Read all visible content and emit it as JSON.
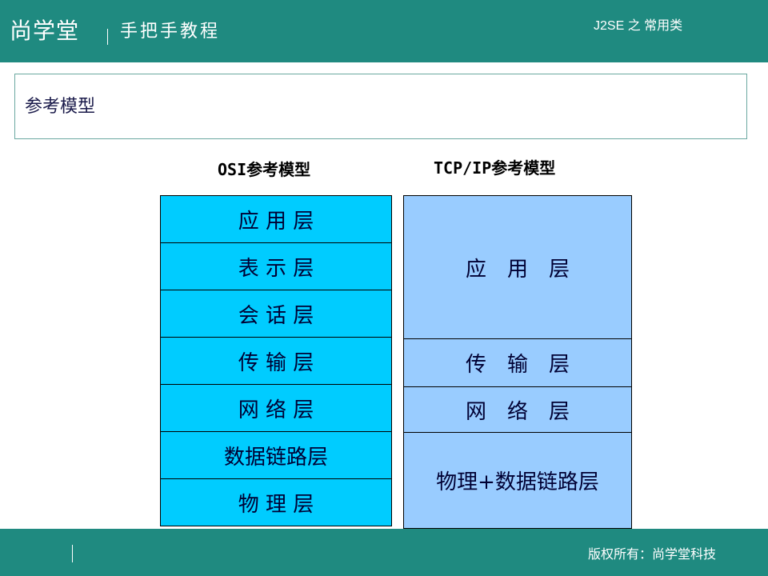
{
  "header": {
    "logo": "尚学堂",
    "slogan": "手把手教程",
    "tag": "J2SE 之 常用类"
  },
  "title": "参考模型",
  "osi": {
    "title": "OSI参考模型",
    "layers": [
      "应 用 层",
      "表 示 层",
      "会 话 层",
      "传 输 层",
      "网 络 层",
      "数据链路层",
      "物 理 层"
    ]
  },
  "tcpip": {
    "title": "TCP/IP参考模型",
    "layers": [
      "应　用　层",
      "传　输　层",
      "网　络　层",
      "物理+数据链路层"
    ]
  },
  "footer": {
    "copyright": "版权所有：尚学堂科技"
  }
}
